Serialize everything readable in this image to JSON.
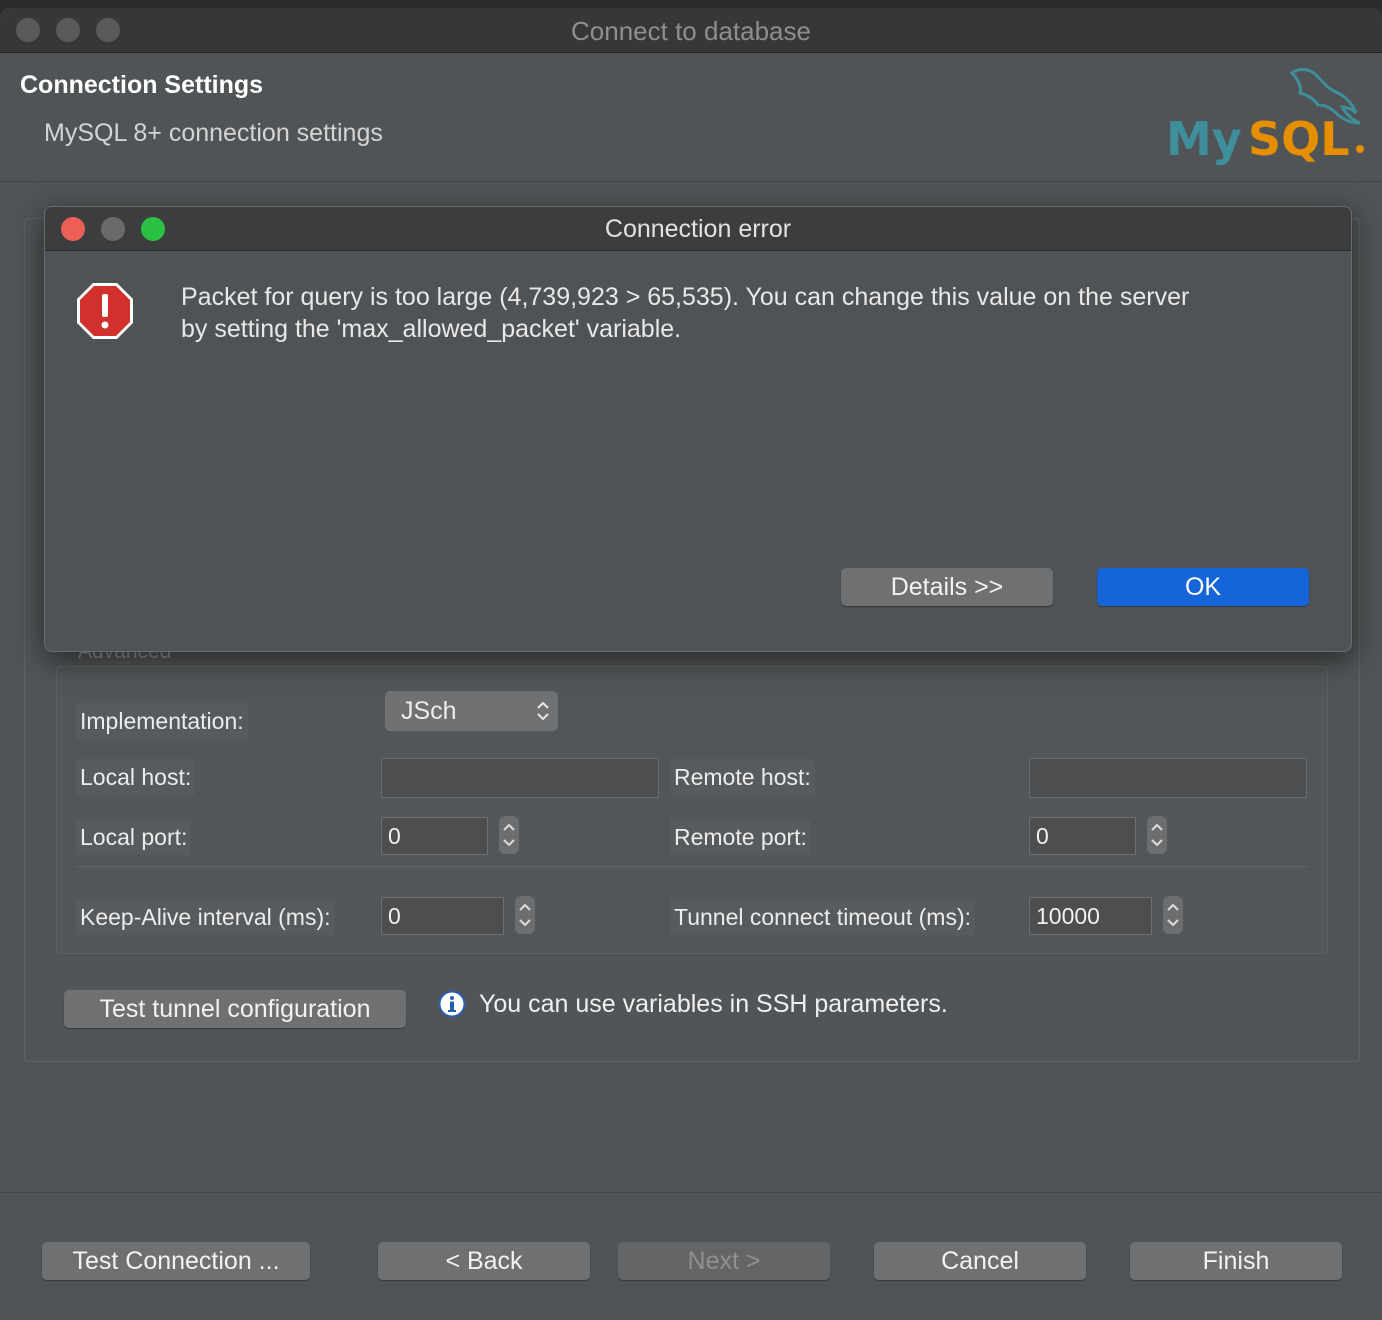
{
  "window": {
    "title": "Connect to database"
  },
  "header": {
    "title": "Connection Settings",
    "subtitle": "MySQL 8+ connection settings",
    "logo_text": "MySQL"
  },
  "advanced": {
    "group_label": "Advanced",
    "implementation_label": "Implementation:",
    "implementation_value": "JSch",
    "local_host_label": "Local host:",
    "local_host_value": "",
    "remote_host_label": "Remote host:",
    "remote_host_value": "",
    "local_port_label": "Local port:",
    "local_port_value": "0",
    "remote_port_label": "Remote port:",
    "remote_port_value": "0",
    "keepalive_label": "Keep-Alive interval (ms):",
    "keepalive_value": "0",
    "tunnel_timeout_label": "Tunnel connect timeout (ms):",
    "tunnel_timeout_value": "10000",
    "test_tunnel_label": "Test tunnel configuration",
    "info_text": "You can use variables in SSH parameters."
  },
  "footer": {
    "test_connection": "Test Connection ...",
    "back": "< Back",
    "next": "Next >",
    "cancel": "Cancel",
    "finish": "Finish"
  },
  "dialog": {
    "title": "Connection error",
    "message_line1": "Packet for query is too large (4,739,923 > 65,535). You can change this value on the server",
    "message_line2": "by setting the 'max_allowed_packet' variable.",
    "details_label": "Details >>",
    "ok_label": "OK"
  },
  "colors": {
    "accent_blue": "#1565d8",
    "error_red": "#d0312d",
    "mysql_teal": "#3e8e9c",
    "mysql_orange": "#e48e00"
  }
}
